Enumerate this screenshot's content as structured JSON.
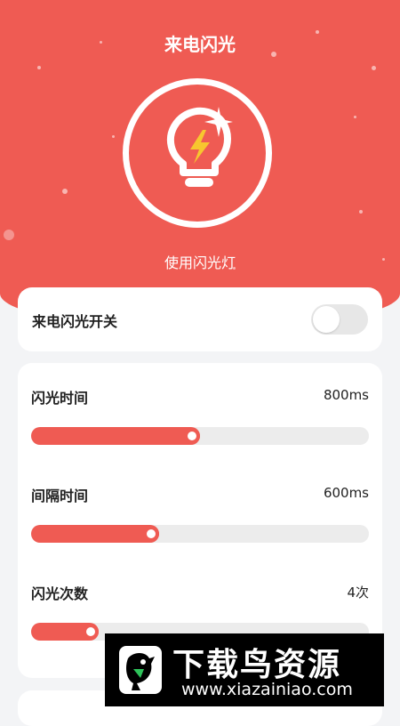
{
  "header": {
    "title": "来电闪光",
    "use_flash_label": "使用闪光灯"
  },
  "switch_card": {
    "label": "来电闪光开关",
    "enabled": false
  },
  "settings": {
    "flash_time": {
      "label": "闪光时间",
      "value": "800ms",
      "level": 0.5
    },
    "interval_time": {
      "label": "间隔时间",
      "value": "600ms",
      "level": 0.38
    },
    "flash_count": {
      "label": "闪光次数",
      "value": "4次",
      "level": 0.2
    }
  },
  "watermark": {
    "name": "下载鸟资源",
    "url": "www.xiazainiao.com"
  },
  "colors": {
    "accent": "#ef5b53",
    "track": "#ececec",
    "background": "#f3f4f6"
  },
  "icons": [
    "flashlight-bulb-icon",
    "lightning-bolt-icon",
    "sparkle-icon"
  ]
}
